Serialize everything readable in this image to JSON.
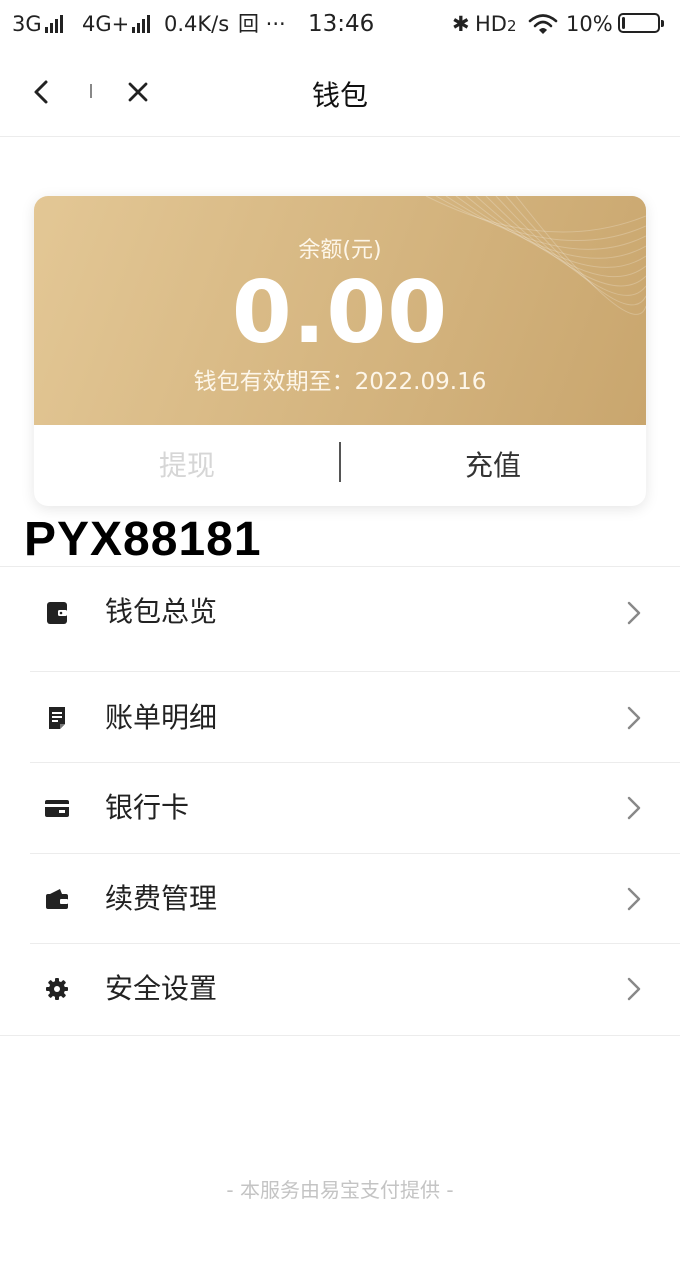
{
  "status_bar": {
    "network_1": "3G",
    "network_2": "4G+",
    "speed": "0.4K/s",
    "extra_icons": "回 ···",
    "time": "13:46",
    "bluetooth": "✱",
    "hd": "HD",
    "hd_sub": "2",
    "battery": "10%",
    "battery_level": 0.1
  },
  "nav": {
    "title": "钱包",
    "back_icon": "chevron-left-icon",
    "close_icon": "close-icon"
  },
  "card": {
    "balance_label": "余额(元)",
    "balance_amount": "0.00",
    "expiry_text": "钱包有效期至：2022.09.16",
    "withdraw_label": "提现",
    "recharge_label": "充值",
    "gradient_start": "#e3c795",
    "gradient_end": "#c9a66e"
  },
  "overlay_code": "PYX88181",
  "menu": {
    "items": [
      {
        "label": "钱包总览",
        "icon": "wallet-icon"
      },
      {
        "label": "账单明细",
        "icon": "bill-icon"
      },
      {
        "label": "银行卡",
        "icon": "bank-card-icon"
      },
      {
        "label": "续费管理",
        "icon": "renewal-wallet-icon"
      },
      {
        "label": "安全设置",
        "icon": "security-gear-icon"
      }
    ],
    "arrow_icon": "chevron-right-icon"
  },
  "footer": {
    "text": "- 本服务由易宝支付提供 -"
  }
}
